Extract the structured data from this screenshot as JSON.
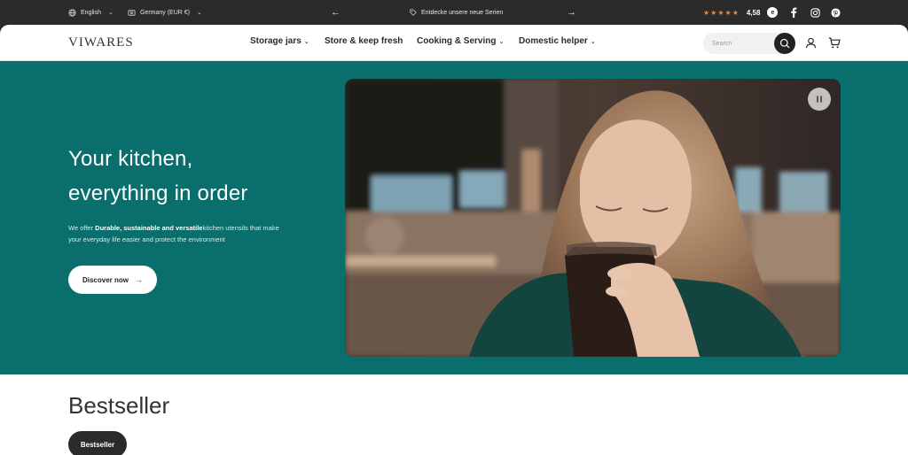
{
  "topbar": {
    "language": "English",
    "country": "Germany (EUR €)",
    "promo": "Entdecke unsere neue Serien",
    "stars": "★★★★★",
    "rating": "4,58",
    "rating_badge": "e",
    "colors": {
      "background": "#2b2b2b",
      "stars": "#e8883a"
    }
  },
  "header": {
    "logo": "VIWARES",
    "nav": [
      {
        "label": "Storage jars",
        "has_dropdown": true
      },
      {
        "label": "Store & keep fresh",
        "has_dropdown": false
      },
      {
        "label": "Cooking & Serving",
        "has_dropdown": true
      },
      {
        "label": "Domestic helper",
        "has_dropdown": true
      }
    ],
    "search_placeholder": "Search"
  },
  "hero": {
    "title_line1": "Your kitchen,",
    "title_line2": "everything in order",
    "text_prefix": "We offer ",
    "text_bold": "Durable, sustainable and versatile",
    "text_suffix": "kitchen utensils that make your everyday life easier and protect the environment",
    "cta": "Discover now",
    "colors": {
      "background": "#0a6e6c"
    }
  },
  "bestseller": {
    "title": "Bestseller",
    "tab": "Bestseller"
  }
}
